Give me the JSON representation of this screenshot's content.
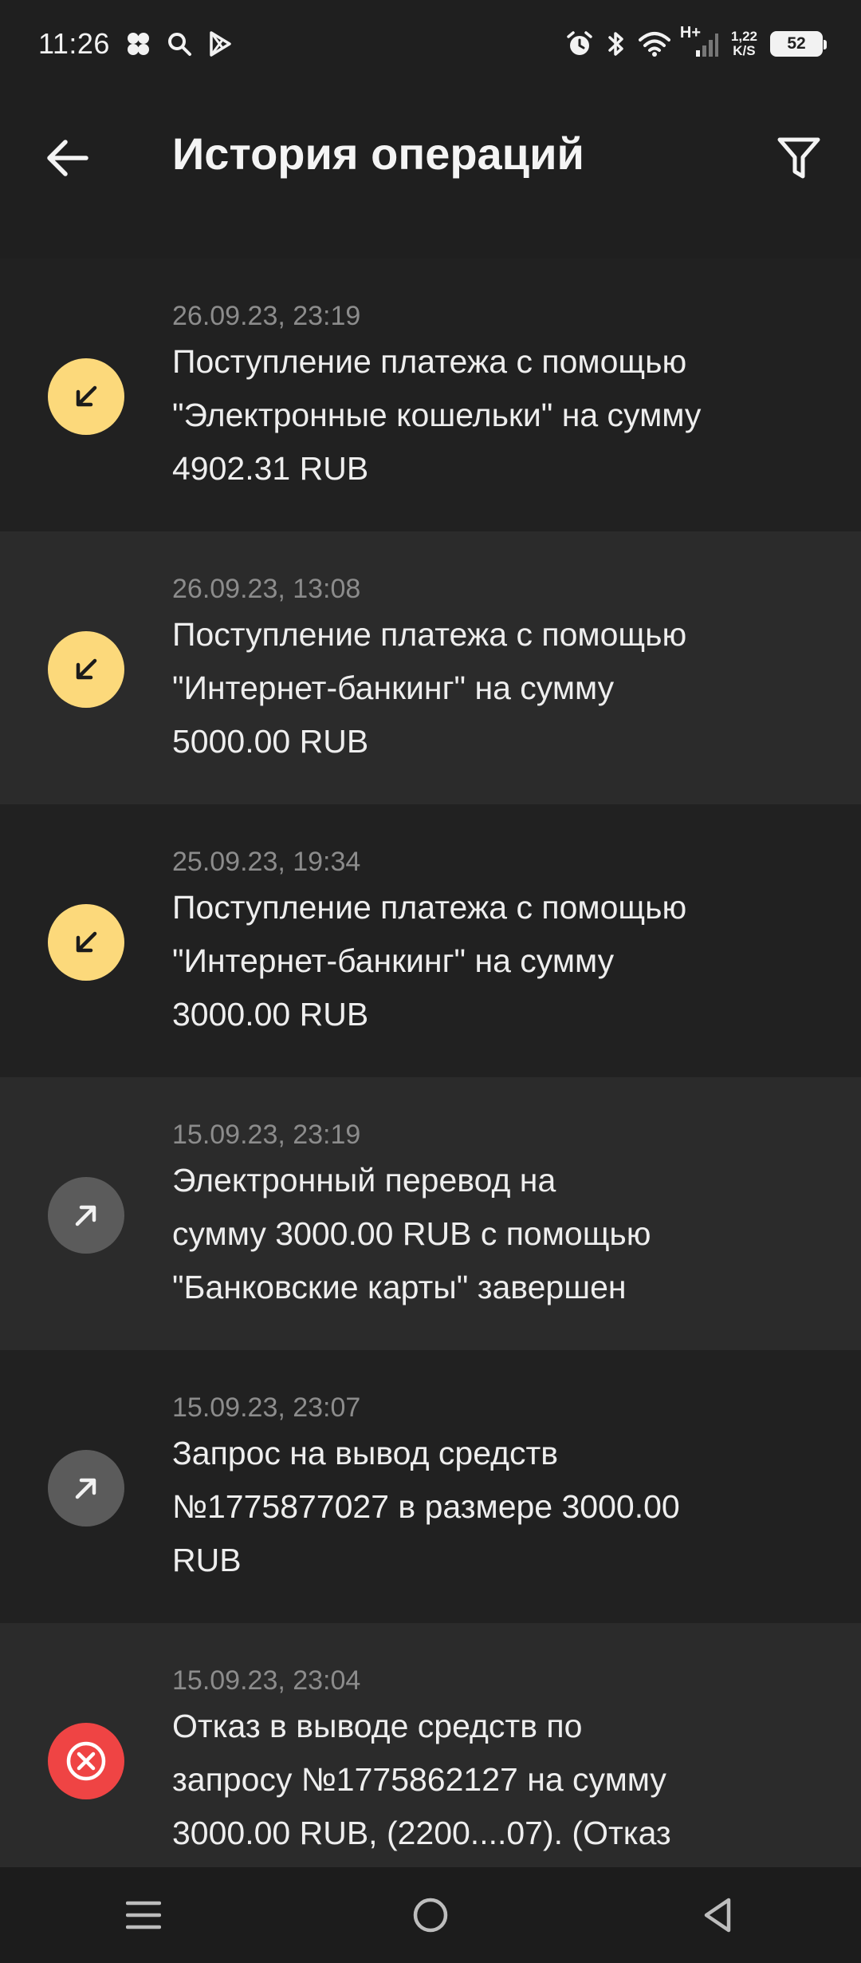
{
  "status_bar": {
    "time": "11:26",
    "network_type": "H+",
    "speed_value": "1,22",
    "speed_unit": "K/S",
    "battery": "52"
  },
  "header": {
    "title": "История операций"
  },
  "operations": [
    {
      "kind": "incoming",
      "date": "26.09.23, 23:19",
      "text": "Поступление платежа с помощью\n\"Электронные кошельки\" на сумму\n4902.31 RUB"
    },
    {
      "kind": "incoming",
      "date": "26.09.23, 13:08",
      "text": "Поступление платежа с помощью\n\"Интернет-банкинг\" на сумму\n5000.00 RUB"
    },
    {
      "kind": "incoming",
      "date": "25.09.23, 19:34",
      "text": "Поступление платежа с помощью\n\"Интернет-банкинг\" на сумму\n3000.00 RUB"
    },
    {
      "kind": "outgoing",
      "date": "15.09.23, 23:19",
      "text": "Электронный перевод на\nсумму 3000.00 RUB с помощью\n\"Банковские карты\" завершен"
    },
    {
      "kind": "outgoing",
      "date": "15.09.23, 23:07",
      "text": "Запрос на вывод средств\n№1775877027 в размере 3000.00\nRUB"
    },
    {
      "kind": "rejected",
      "date": "15.09.23, 23:04",
      "text": "Отказ в выводе средств по\nзапросу №1775862127 на сумму\n3000.00 RUB,  (2200....07). (Отказ"
    }
  ],
  "colors": {
    "incoming_icon": "#fcd97b",
    "outgoing_icon": "#5b5b5b",
    "rejected_icon": "#ef4444"
  }
}
